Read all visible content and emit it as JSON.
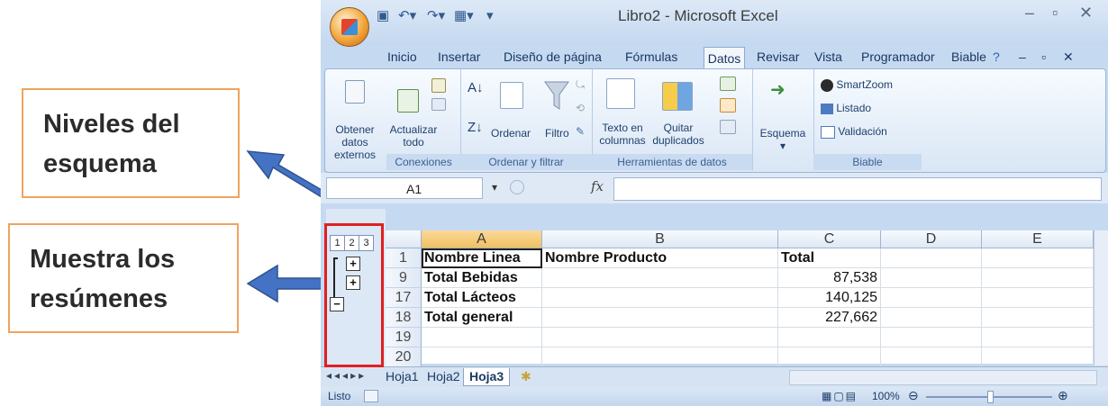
{
  "callouts": {
    "outline_levels": [
      "Niveles del",
      "esquema"
    ],
    "shows_summaries": [
      "Muestra los",
      "resúmenes"
    ]
  },
  "window": {
    "title": "Libro2 - Microsoft Excel"
  },
  "tabs": [
    "Inicio",
    "Insertar",
    "Diseño de página",
    "Fórmulas",
    "Datos",
    "Revisar",
    "Vista",
    "Programador",
    "Biable"
  ],
  "active_tab": "Datos",
  "ribbon": {
    "get_external": [
      "Obtener datos",
      "externos"
    ],
    "refresh": [
      "Actualizar",
      "todo"
    ],
    "sort": "Ordenar",
    "filter": "Filtro",
    "text_to_columns": [
      "Texto en",
      "columnas"
    ],
    "remove_duplicates": [
      "Quitar",
      "duplicados"
    ],
    "outline": "Esquema",
    "smartzoom": "SmartZoom",
    "listado": "Listado",
    "validacion": "Validación",
    "groups": {
      "connections": "Conexiones",
      "sort_filter": "Ordenar y filtrar",
      "data_tools": "Herramientas de datos",
      "biable": "Biable"
    }
  },
  "formula_bar": {
    "name_box": "A1",
    "fx": "fx",
    "formula": ""
  },
  "outline": {
    "levels": [
      "1",
      "2",
      "3"
    ],
    "expand": "+",
    "collapse": "−"
  },
  "grid": {
    "columns": [
      "A",
      "B",
      "C",
      "D",
      "E"
    ],
    "rows": [
      {
        "num": "1",
        "a": "Nombre Linea",
        "b": "Nombre Producto",
        "c": "Total"
      },
      {
        "num": "9",
        "a": "Total Bebidas",
        "b": "",
        "c": "87,538"
      },
      {
        "num": "17",
        "a": "Total Lácteos",
        "b": "",
        "c": "140,125"
      },
      {
        "num": "18",
        "a": "Total general",
        "b": "",
        "c": "227,662"
      },
      {
        "num": "19",
        "a": "",
        "b": "",
        "c": ""
      },
      {
        "num": "20",
        "a": "",
        "b": "",
        "c": ""
      }
    ]
  },
  "sheets": [
    "Hoja1",
    "Hoja2",
    "Hoja3"
  ],
  "active_sheet": "Hoja3",
  "status": {
    "ready": "Listo",
    "zoom": "100%"
  },
  "colors": {
    "highlight_box": "#e02020",
    "callout_border": "#f0a35e",
    "arrow": "#4472c4"
  }
}
